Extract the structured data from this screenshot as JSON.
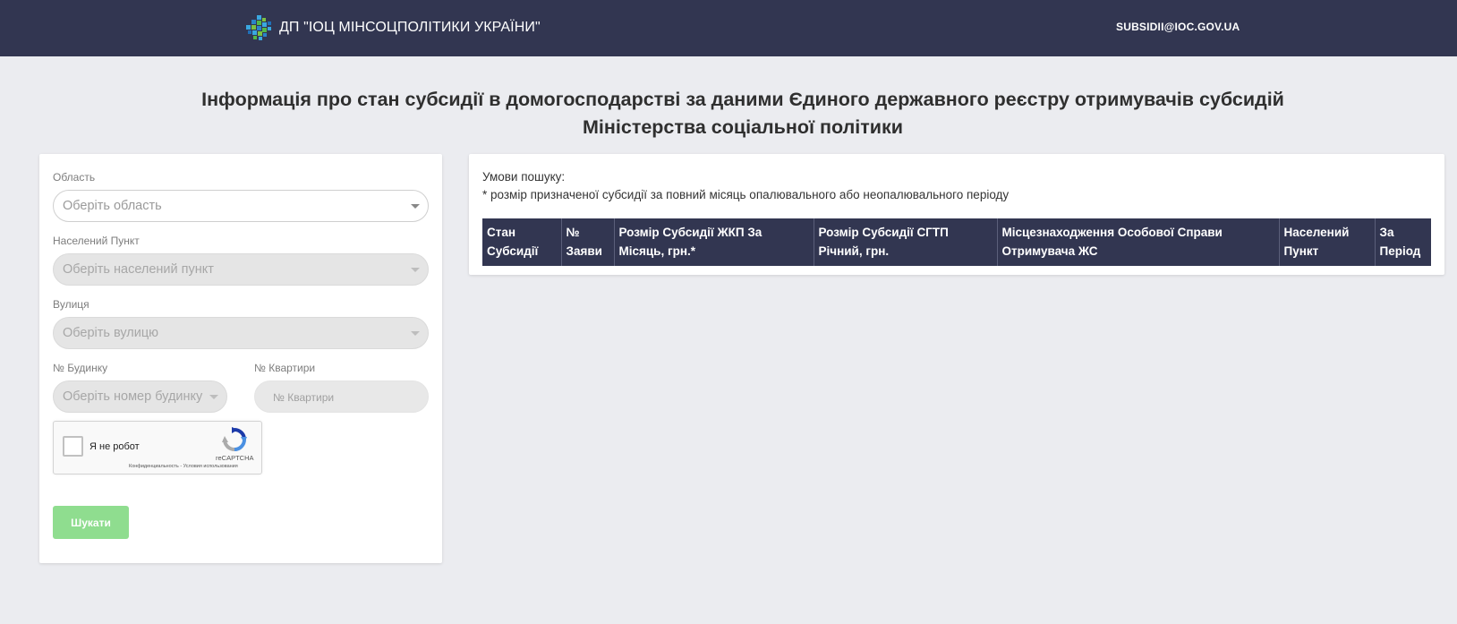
{
  "header": {
    "org_name": "ДП \"ІОЦ МІНСОЦПОЛІТИКИ УКРАЇНИ\"",
    "email": "SUBSIDII@IOC.GOV.UA",
    "bg_color": "#323651"
  },
  "page": {
    "title_line1": "Інформація про стан субсидії в домогосподарстві за даними Єдиного державного реєстру отримувачів субсидій",
    "title_line2": "Міністерства соціальної політики"
  },
  "form": {
    "region_label": "Область",
    "region_placeholder": "Оберіть область",
    "settlement_label": "Населений Пункт",
    "settlement_placeholder": "Оберіть населений пункт",
    "street_label": "Вулиця",
    "street_placeholder": "Оберіть вулицю",
    "house_label": "№ Будинку",
    "house_placeholder": "Оберіть номер будинку",
    "apartment_label": "№ Квартири",
    "apartment_placeholder": "№ Квартири",
    "captcha": {
      "label": "Я не робот",
      "brand": "reCAPTCHA",
      "links": "Конфиденциальность - Условия использования"
    },
    "search_button": "Шукати",
    "search_button_color": "#8fdd8f"
  },
  "results": {
    "conditions_title": "Умови пошуку:",
    "conditions_note": "* розмір призначеної субсидії за повний місяць опалювального або неопалювального періоду",
    "columns": [
      "Стан Субсидії",
      "№ Заяви",
      "Розмір Субсидії ЖКП За Місяць, грн.*",
      "Розмір Субсидії СГТП Річний, грн.",
      "Місцезнаходження Особової Справи Отримувача ЖС",
      "Населений Пункт",
      "За Період"
    ],
    "rows": []
  }
}
